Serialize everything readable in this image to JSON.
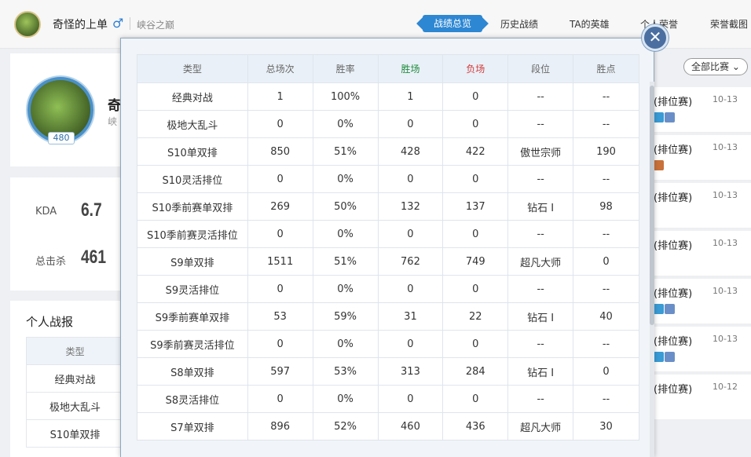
{
  "header": {
    "player_name": "奇怪的上单",
    "gender_symbol": "♂",
    "server": "峡谷之巅",
    "tabs": [
      "战绩总览",
      "历史战绩",
      "TA的英雄",
      "个人荣誉",
      "荣誉截图"
    ],
    "active_tab": 0
  },
  "profile": {
    "level": "480",
    "name_peek": "奇",
    "sub_peek": "峡"
  },
  "stats": {
    "kda_label": "KDA",
    "kda_value": "6.7",
    "kills_label": "总击杀",
    "kills_value": "461"
  },
  "report": {
    "title": "个人战报",
    "header": "类型",
    "rows": [
      "经典对战",
      "极地大乱斗",
      "S10单双排"
    ]
  },
  "match_list": {
    "filter_label": "全部比赛",
    "items": [
      {
        "mode": "(排位赛)",
        "date": "10-13"
      },
      {
        "mode": "(排位赛)",
        "date": "10-13"
      },
      {
        "mode": "(排位赛)",
        "date": "10-13"
      },
      {
        "mode": "(排位赛)",
        "date": "10-13"
      },
      {
        "mode": "(排位赛)",
        "date": "10-13"
      },
      {
        "mode": "(排位赛)",
        "date": "10-13"
      },
      {
        "mode": "(排位赛)",
        "date": "10-12"
      }
    ]
  },
  "overview": {
    "columns": [
      "类型",
      "总场次",
      "胜率",
      "胜场",
      "负场",
      "段位",
      "胜点"
    ],
    "rows": [
      [
        "经典对战",
        "1",
        "100%",
        "1",
        "0",
        "--",
        "--"
      ],
      [
        "极地大乱斗",
        "0",
        "0%",
        "0",
        "0",
        "--",
        "--"
      ],
      [
        "S10单双排",
        "850",
        "51%",
        "428",
        "422",
        "傲世宗师",
        "190"
      ],
      [
        "S10灵活排位",
        "0",
        "0%",
        "0",
        "0",
        "--",
        "--"
      ],
      [
        "S10季前赛单双排",
        "269",
        "50%",
        "132",
        "137",
        "钻石 Ⅰ",
        "98"
      ],
      [
        "S10季前赛灵活排位",
        "0",
        "0%",
        "0",
        "0",
        "--",
        "--"
      ],
      [
        "S9单双排",
        "1511",
        "51%",
        "762",
        "749",
        "超凡大师",
        "0"
      ],
      [
        "S9灵活排位",
        "0",
        "0%",
        "0",
        "0",
        "--",
        "--"
      ],
      [
        "S9季前赛单双排",
        "53",
        "59%",
        "31",
        "22",
        "钻石 Ⅰ",
        "40"
      ],
      [
        "S9季前赛灵活排位",
        "0",
        "0%",
        "0",
        "0",
        "--",
        "--"
      ],
      [
        "S8单双排",
        "597",
        "53%",
        "313",
        "284",
        "钻石 Ⅰ",
        "0"
      ],
      [
        "S8灵活排位",
        "0",
        "0%",
        "0",
        "0",
        "--",
        "--"
      ],
      [
        "S7单双排",
        "896",
        "52%",
        "460",
        "436",
        "超凡大师",
        "30"
      ]
    ],
    "close_symbol": "✕"
  }
}
